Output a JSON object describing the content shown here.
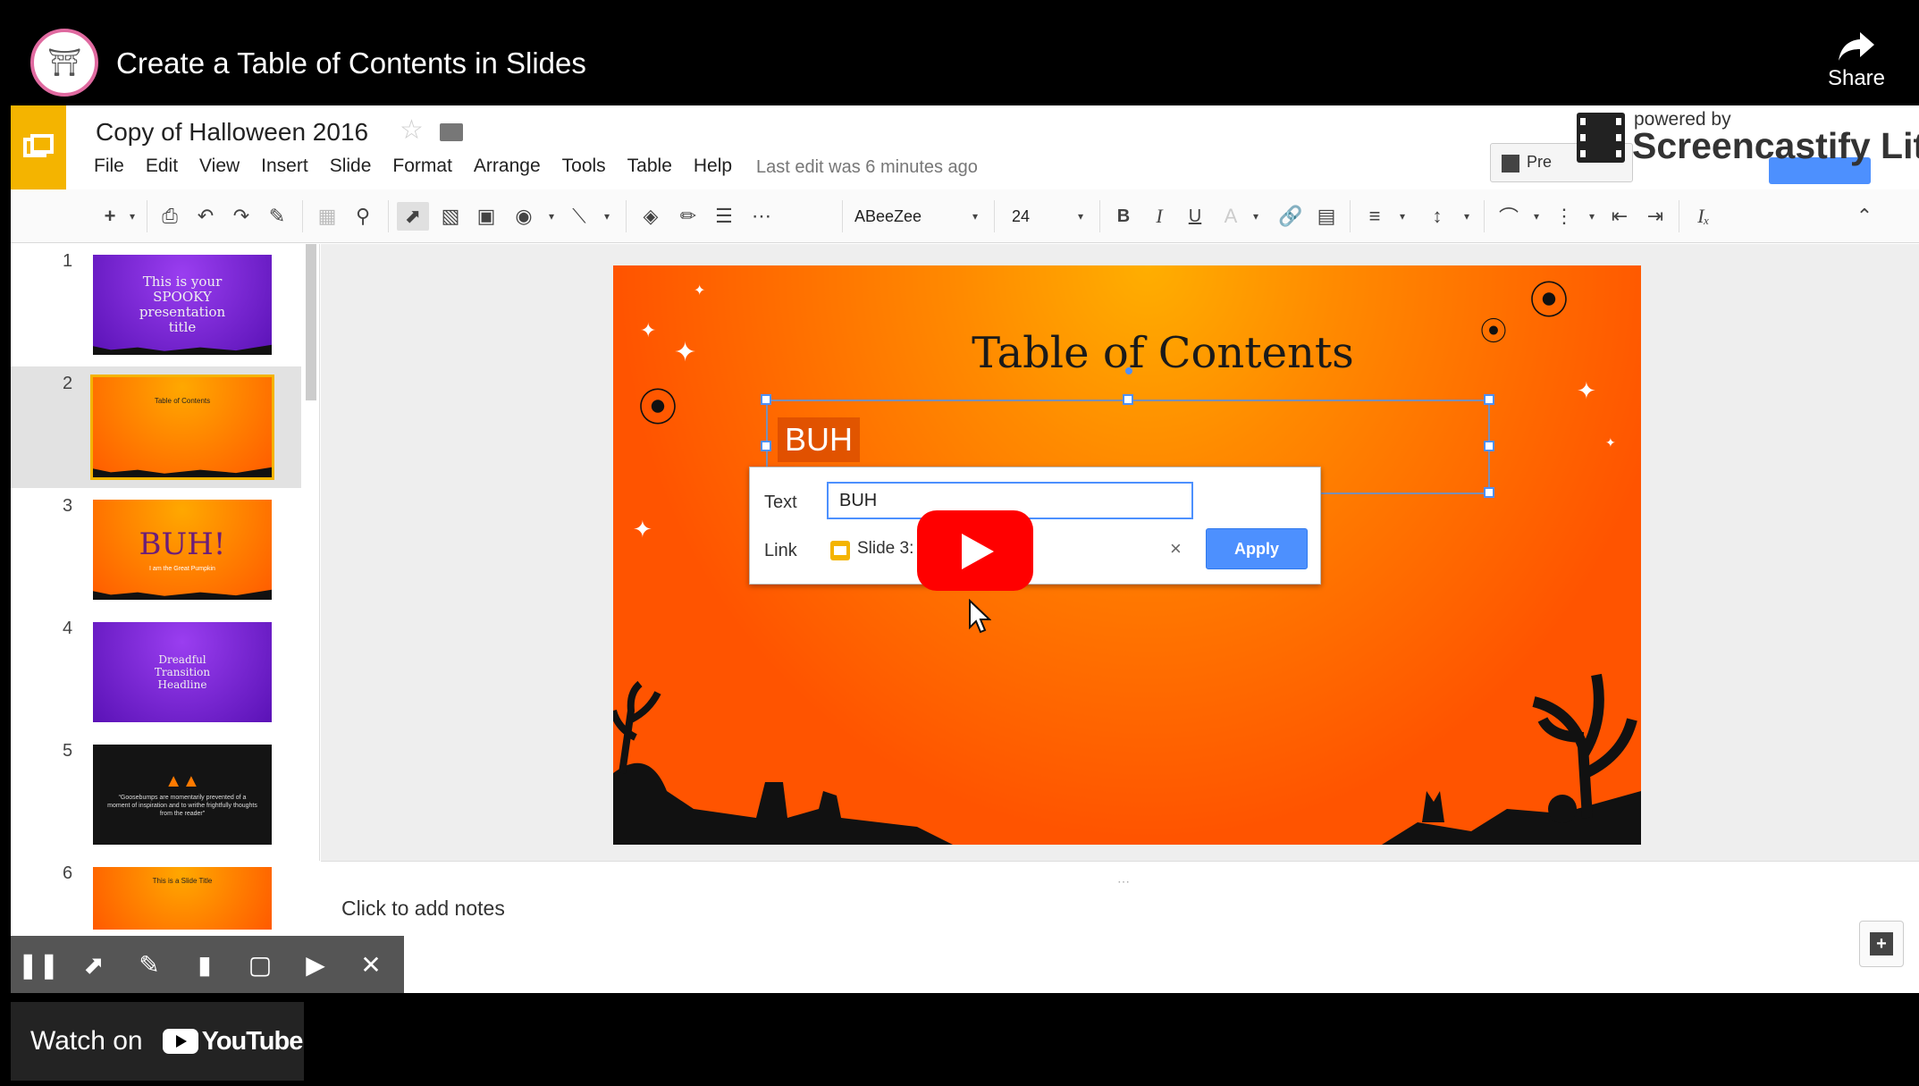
{
  "video": {
    "title": "Create a Table of Contents in Slides",
    "share_label": "Share",
    "watch_on_label": "Watch on",
    "youtube_wordmark": "YouTube"
  },
  "app": {
    "doc_title": "Copy of Halloween 2016",
    "menu": [
      "File",
      "Edit",
      "View",
      "Insert",
      "Slide",
      "Format",
      "Arrange",
      "Tools",
      "Table",
      "Help"
    ],
    "last_edit": "Last edit was 6 minutes ago",
    "present_label": "Pre",
    "brand_color": "#f4b400"
  },
  "watermark": {
    "powered_by": "powered by",
    "name": "Screencastify Lite"
  },
  "toolbar": {
    "font": "ABeeZee",
    "font_size": "24"
  },
  "filmstrip": [
    {
      "num": "1",
      "title": "This is your SPOOKY presentation title"
    },
    {
      "num": "2",
      "title": "Table of Contents"
    },
    {
      "num": "3",
      "title": "BUH!",
      "sub": "I am the Great Pumpkin"
    },
    {
      "num": "4",
      "title": "Dreadful Transition Headline"
    },
    {
      "num": "5",
      "title": "“Goosebumps are momentarily prevented of a moment of inspiration and to writhe frightfully thoughts from the reader”"
    },
    {
      "num": "6",
      "title": "This is a Slide Title"
    }
  ],
  "slide": {
    "title": "Table of Contents",
    "selected_text": "BUH"
  },
  "link_dialog": {
    "text_label": "Text",
    "text_value": "BUH",
    "link_label": "Link",
    "link_value": "Slide 3:",
    "apply_label": "Apply"
  },
  "notes": {
    "placeholder": "Click to add notes"
  }
}
